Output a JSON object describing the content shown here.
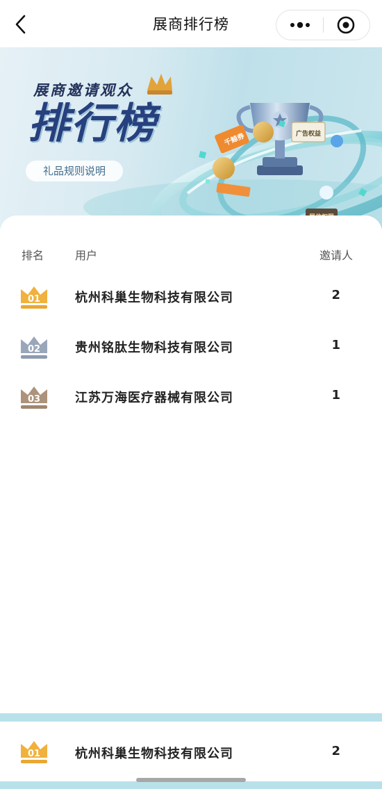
{
  "nav": {
    "title": "展商排行榜",
    "back_icon": "chevron-left-icon",
    "more_icon": "more-dots-icon",
    "close_icon": "target-circle-icon"
  },
  "banner": {
    "subtitle": "展商邀请观众",
    "title": "排行榜",
    "rules_label": "礼品规则说明",
    "tags": [
      "千鲸券",
      "广告权益",
      "展位权限"
    ]
  },
  "table": {
    "headers": {
      "rank": "排名",
      "user": "用户",
      "invites": "邀请人"
    },
    "rows": [
      {
        "rank": "01",
        "company": "杭州科巢生物科技有限公司",
        "invites": "2",
        "medal": "gold"
      },
      {
        "rank": "02",
        "company": "贵州铭肽生物科技有限公司",
        "invites": "1",
        "medal": "silver"
      },
      {
        "rank": "03",
        "company": "江苏万海医疗器械有限公司",
        "invites": "1",
        "medal": "bronze"
      }
    ]
  },
  "my_rank": {
    "rank": "01",
    "company": "杭州科巢生物科技有限公司",
    "invites": "2",
    "medal": "gold"
  },
  "colors": {
    "gold": "#e9a833",
    "silver": "#8e9bb0",
    "bronze": "#a08670",
    "accent": "#27407e",
    "bottom_bar": "#b9e1ea"
  }
}
